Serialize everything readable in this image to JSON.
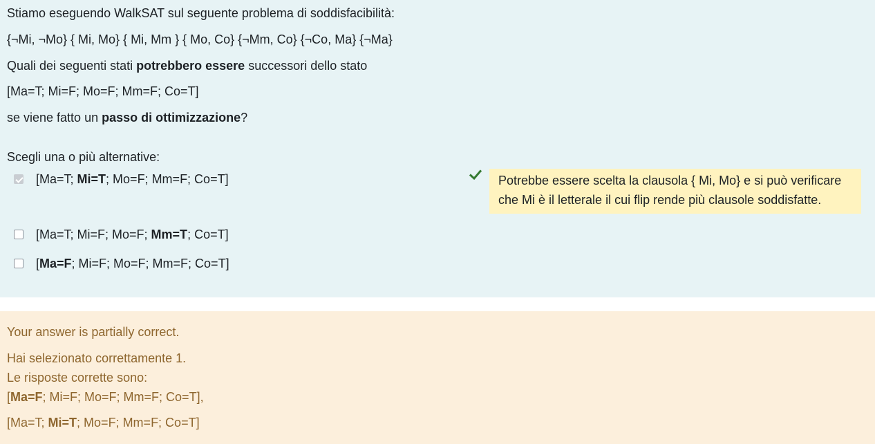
{
  "question": {
    "intro": "Stiamo eseguendo WalkSAT sul seguente problema di soddisfacibilità:",
    "clauses": " {¬Mi, ¬Mo}  { Mi, Mo}  { Mi, Mm }  { Mo, Co}  {¬Mm, Co} {¬Co, Ma} {¬Ma}",
    "ask_prefix": "Quali dei seguenti stati ",
    "ask_bold": "potrebbero essere",
    "ask_suffix": " successori dello stato",
    "state": "[Ma=T; Mi=F; Mo=F; Mm=F; Co=T]",
    "step_prefix": "se viene fatto un ",
    "step_bold": "passo di ottimizzazione",
    "step_suffix": "?",
    "choose_label": "Scegli una o più alternative:"
  },
  "options": [
    {
      "checked": true,
      "prefix": "[Ma=T; ",
      "bold": "Mi=T",
      "suffix": "; Mo=F; Mm=F; Co=T]"
    },
    {
      "checked": false,
      "prefix": "[Ma=T; Mi=F; Mo=F; ",
      "bold": "Mm=T",
      "suffix": "; Co=T]"
    },
    {
      "checked": false,
      "prefix": "[",
      "bold": "Ma=F",
      "suffix": "; Mi=F; Mo=F; Mm=F; Co=T]"
    }
  ],
  "option_feedback": {
    "icon": "check-icon",
    "tick_color": "#357a32",
    "line1": "Potrebbe essere scelta la clausola { Mi, Mo}  e si può verificare",
    "line2": "che Mi è il letterale il cui flip rende più clausole soddisfatte."
  },
  "feedback": {
    "status": "Your answer is partially correct.",
    "selected_correct": "Hai selezionato correttamente 1.",
    "correct_answers_label": "Le risposte corrette sono:",
    "answer1_prefix": "[",
    "answer1_bold": "Ma=F",
    "answer1_suffix": "; Mi=F; Mo=F; Mm=F; Co=T],",
    "answer2_prefix": "[Ma=T; ",
    "answer2_bold": "Mi=T",
    "answer2_suffix": "; Mo=F; Mm=F; Co=T]"
  },
  "colors": {
    "question_bg": "#e7f3f5",
    "feedback_bg": "#fcefdc",
    "feedback_text": "#8e662e",
    "specific_feedback_bg": "#fff3bf"
  }
}
